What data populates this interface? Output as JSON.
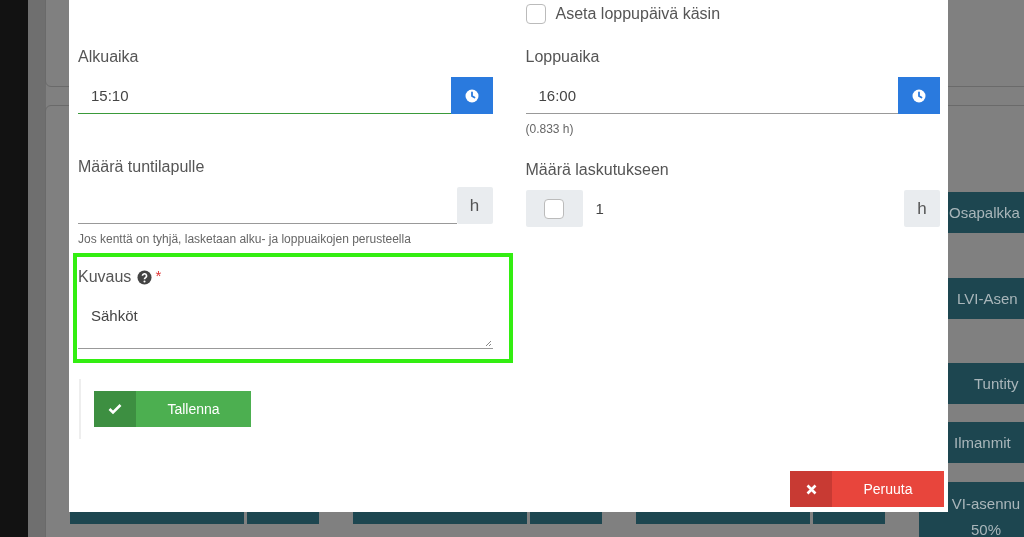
{
  "modal": {
    "end_date_manual": {
      "label": "Aseta loppupäivä käsin",
      "checked": false
    },
    "start_time": {
      "label": "Alkuaika",
      "value": "15:10",
      "focused": true
    },
    "end_time": {
      "label": "Loppuaika",
      "value": "16:00",
      "duration": "(0.833 h)",
      "focused": false
    },
    "timesheet_amount": {
      "label": "Määrä tuntilapulle",
      "unit": "h",
      "help": "Jos kenttä on tyhjä, lasketaan alku- ja loppuaikojen perusteella"
    },
    "billing_amount": {
      "label": "Määrä laskutukseen",
      "checked": false,
      "value": "1",
      "unit": "h"
    },
    "description": {
      "label": "Kuvaus",
      "required_mark": "*",
      "value": "Sähköt",
      "highlighted": true
    },
    "save_button": "Tallenna",
    "cancel_button": "Peruuta"
  },
  "background_buttons": [
    {
      "label": "Osapalkka"
    },
    {
      "label": "LVI-Asen"
    },
    {
      "label": "Tuntity"
    },
    {
      "label": "Ilmanmit"
    },
    {
      "label": "VI-asennu 50%"
    }
  ]
}
